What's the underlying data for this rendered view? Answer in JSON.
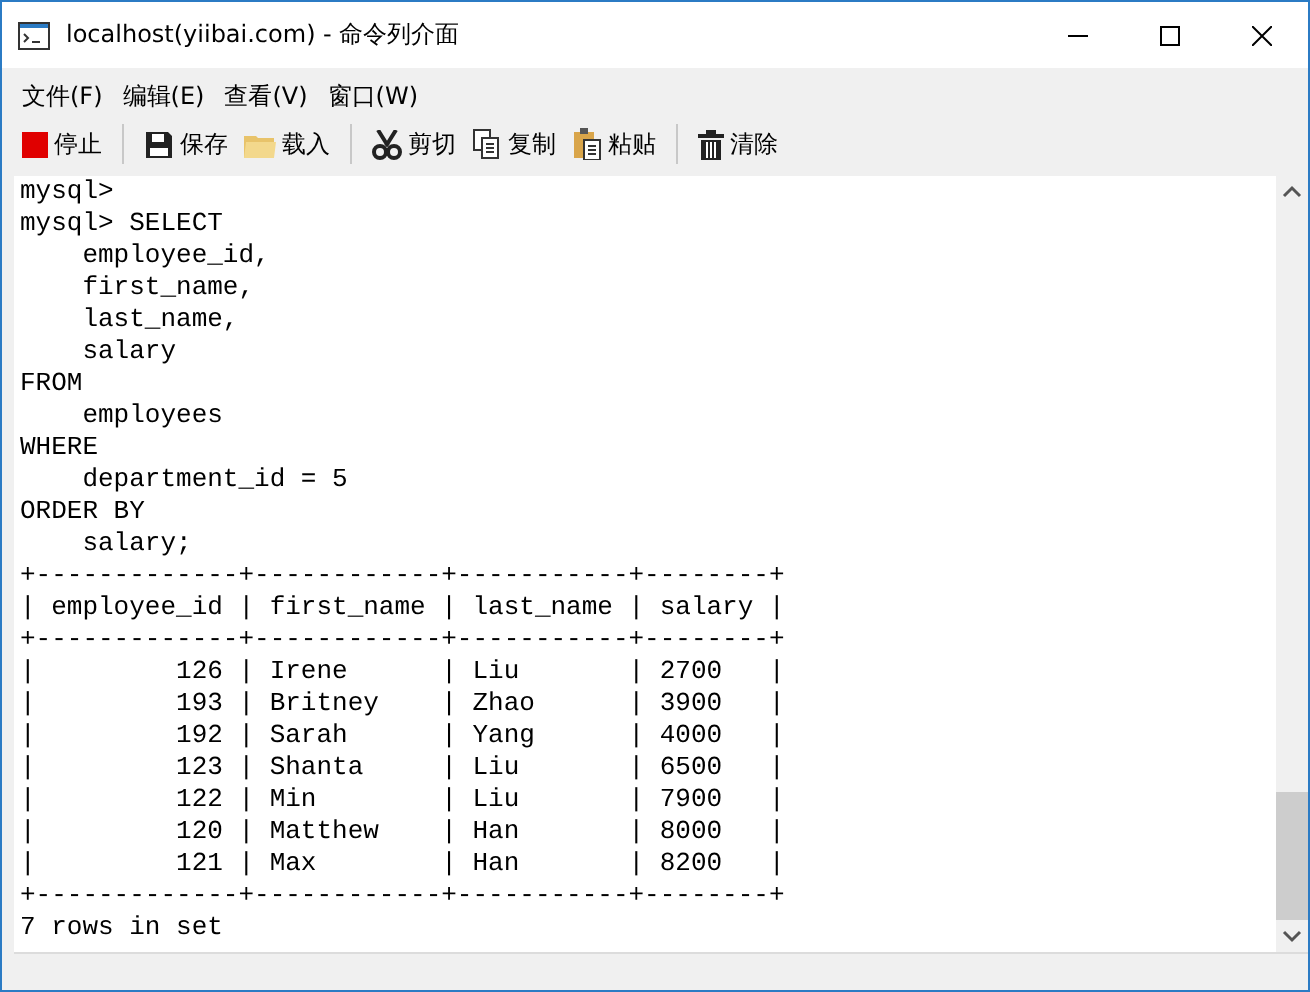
{
  "window": {
    "title": "localhost(yiibai.com) - 命令列介面"
  },
  "menu": [
    "文件(F)",
    "编辑(E)",
    "查看(V)",
    "窗口(W)"
  ],
  "toolbar": [
    [
      "停止"
    ],
    [
      "保存",
      "载入"
    ],
    [
      "剪切",
      "复制",
      "粘贴"
    ],
    [
      "清除"
    ]
  ],
  "console": {
    "lines": [
      "mysql>",
      "mysql> SELECT",
      "    employee_id,",
      "    first_name,",
      "    last_name,",
      "    salary",
      "FROM",
      "    employees",
      "WHERE",
      "    department_id = 5",
      "ORDER BY",
      "    salary;",
      "+-------------+------------+-----------+--------+",
      "| employee_id | first_name | last_name | salary |",
      "+-------------+------------+-----------+--------+",
      "|         126 | Irene      | Liu       | 2700   |",
      "|         193 | Britney    | Zhao      | 3900   |",
      "|         192 | Sarah      | Yang      | 4000   |",
      "|         123 | Shanta     | Liu       | 6500   |",
      "|         122 | Min        | Liu       | 7900   |",
      "|         120 | Matthew    | Han       | 8000   |",
      "|         121 | Max        | Han       | 8200   |",
      "+-------------+------------+-----------+--------+",
      "7 rows in set"
    ]
  }
}
